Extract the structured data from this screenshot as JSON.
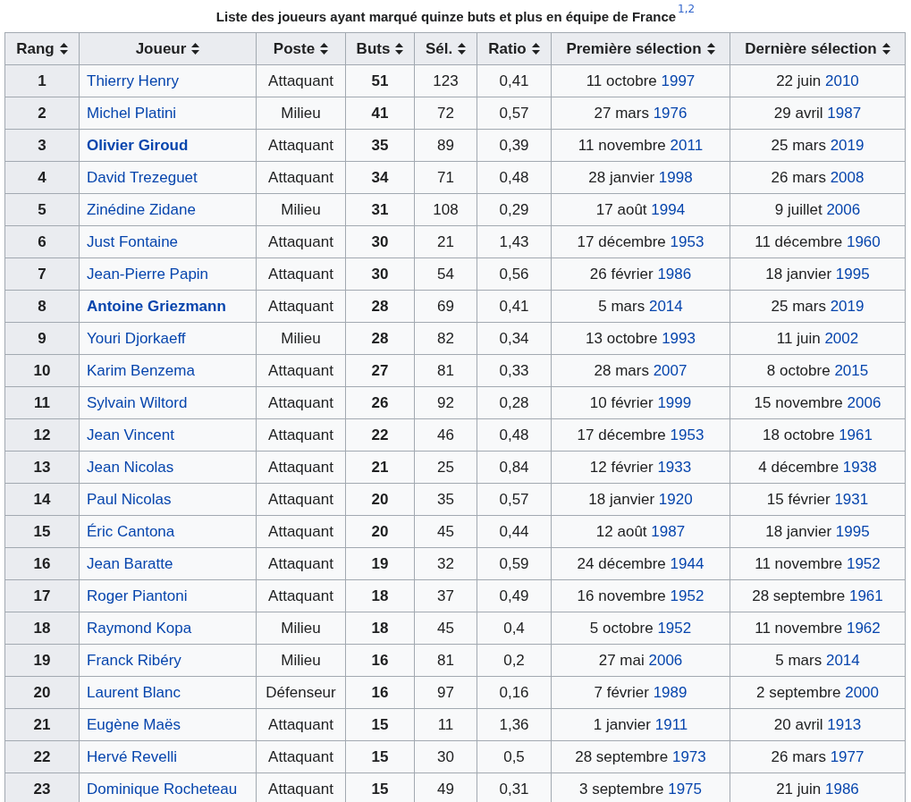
{
  "caption": {
    "text": "Liste des joueurs ayant marqué quinze buts et plus en équipe de France",
    "note": "1,2"
  },
  "columns": [
    "Rang",
    "Joueur",
    "Poste",
    "Buts",
    "Sél.",
    "Ratio",
    "Première sélection",
    "Dernière sélection"
  ],
  "rows": [
    {
      "rank": "1",
      "player": "Thierry Henry",
      "active": false,
      "position": "Attaquant",
      "goals": "51",
      "caps": "123",
      "ratio": "0,41",
      "first": {
        "day": "11 octobre",
        "year": "1997"
      },
      "last": {
        "day": "22 juin",
        "year": "2010"
      }
    },
    {
      "rank": "2",
      "player": "Michel Platini",
      "active": false,
      "position": "Milieu",
      "goals": "41",
      "caps": "72",
      "ratio": "0,57",
      "first": {
        "day": "27 mars",
        "year": "1976"
      },
      "last": {
        "day": "29 avril",
        "year": "1987"
      }
    },
    {
      "rank": "3",
      "player": "Olivier Giroud",
      "active": true,
      "position": "Attaquant",
      "goals": "35",
      "caps": "89",
      "ratio": "0,39",
      "first": {
        "day": "11 novembre",
        "year": "2011"
      },
      "last": {
        "day": "25 mars",
        "year": "2019"
      }
    },
    {
      "rank": "4",
      "player": "David Trezeguet",
      "active": false,
      "position": "Attaquant",
      "goals": "34",
      "caps": "71",
      "ratio": "0,48",
      "first": {
        "day": "28 janvier",
        "year": "1998"
      },
      "last": {
        "day": "26 mars",
        "year": "2008"
      }
    },
    {
      "rank": "5",
      "player": "Zinédine Zidane",
      "active": false,
      "position": "Milieu",
      "goals": "31",
      "caps": "108",
      "ratio": "0,29",
      "first": {
        "day": "17 août",
        "year": "1994"
      },
      "last": {
        "day": "9 juillet",
        "year": "2006"
      }
    },
    {
      "rank": "6",
      "player": "Just Fontaine",
      "active": false,
      "position": "Attaquant",
      "goals": "30",
      "caps": "21",
      "ratio": "1,43",
      "first": {
        "day": "17 décembre",
        "year": "1953"
      },
      "last": {
        "day": "11 décembre",
        "year": "1960"
      }
    },
    {
      "rank": "7",
      "player": "Jean-Pierre Papin",
      "active": false,
      "position": "Attaquant",
      "goals": "30",
      "caps": "54",
      "ratio": "0,56",
      "first": {
        "day": "26 février",
        "year": "1986"
      },
      "last": {
        "day": "18 janvier",
        "year": "1995"
      }
    },
    {
      "rank": "8",
      "player": "Antoine Griezmann",
      "active": true,
      "position": "Attaquant",
      "goals": "28",
      "caps": "69",
      "ratio": "0,41",
      "first": {
        "day": "5 mars",
        "year": "2014"
      },
      "last": {
        "day": "25 mars",
        "year": "2019"
      }
    },
    {
      "rank": "9",
      "player": "Youri Djorkaeff",
      "active": false,
      "position": "Milieu",
      "goals": "28",
      "caps": "82",
      "ratio": "0,34",
      "first": {
        "day": "13 octobre",
        "year": "1993"
      },
      "last": {
        "day": "11 juin",
        "year": "2002"
      }
    },
    {
      "rank": "10",
      "player": "Karim Benzema",
      "active": false,
      "position": "Attaquant",
      "goals": "27",
      "caps": "81",
      "ratio": "0,33",
      "first": {
        "day": "28 mars",
        "year": "2007"
      },
      "last": {
        "day": "8 octobre",
        "year": "2015"
      }
    },
    {
      "rank": "11",
      "player": "Sylvain Wiltord",
      "active": false,
      "position": "Attaquant",
      "goals": "26",
      "caps": "92",
      "ratio": "0,28",
      "first": {
        "day": "10 février",
        "year": "1999"
      },
      "last": {
        "day": "15 novembre",
        "year": "2006"
      }
    },
    {
      "rank": "12",
      "player": "Jean Vincent",
      "active": false,
      "position": "Attaquant",
      "goals": "22",
      "caps": "46",
      "ratio": "0,48",
      "first": {
        "day": "17 décembre",
        "year": "1953"
      },
      "last": {
        "day": "18 octobre",
        "year": "1961"
      }
    },
    {
      "rank": "13",
      "player": "Jean Nicolas",
      "active": false,
      "position": "Attaquant",
      "goals": "21",
      "caps": "25",
      "ratio": "0,84",
      "first": {
        "day": "12 février",
        "year": "1933"
      },
      "last": {
        "day": "4 décembre",
        "year": "1938"
      }
    },
    {
      "rank": "14",
      "player": "Paul Nicolas",
      "active": false,
      "position": "Attaquant",
      "goals": "20",
      "caps": "35",
      "ratio": "0,57",
      "first": {
        "day": "18 janvier",
        "year": "1920"
      },
      "last": {
        "day": "15 février",
        "year": "1931"
      }
    },
    {
      "rank": "15",
      "player": "Éric Cantona",
      "active": false,
      "position": "Attaquant",
      "goals": "20",
      "caps": "45",
      "ratio": "0,44",
      "first": {
        "day": "12 août",
        "year": "1987"
      },
      "last": {
        "day": "18 janvier",
        "year": "1995"
      }
    },
    {
      "rank": "16",
      "player": "Jean Baratte",
      "active": false,
      "position": "Attaquant",
      "goals": "19",
      "caps": "32",
      "ratio": "0,59",
      "first": {
        "day": "24 décembre",
        "year": "1944"
      },
      "last": {
        "day": "11 novembre",
        "year": "1952"
      }
    },
    {
      "rank": "17",
      "player": "Roger Piantoni",
      "active": false,
      "position": "Attaquant",
      "goals": "18",
      "caps": "37",
      "ratio": "0,49",
      "first": {
        "day": "16 novembre",
        "year": "1952"
      },
      "last": {
        "day": "28 septembre",
        "year": "1961"
      }
    },
    {
      "rank": "18",
      "player": "Raymond Kopa",
      "active": false,
      "position": "Milieu",
      "goals": "18",
      "caps": "45",
      "ratio": "0,4",
      "first": {
        "day": "5 octobre",
        "year": "1952"
      },
      "last": {
        "day": "11 novembre",
        "year": "1962"
      }
    },
    {
      "rank": "19",
      "player": "Franck Ribéry",
      "active": false,
      "position": "Milieu",
      "goals": "16",
      "caps": "81",
      "ratio": "0,2",
      "first": {
        "day": "27 mai",
        "year": "2006"
      },
      "last": {
        "day": "5 mars",
        "year": "2014"
      }
    },
    {
      "rank": "20",
      "player": "Laurent Blanc",
      "active": false,
      "position": "Défenseur",
      "goals": "16",
      "caps": "97",
      "ratio": "0,16",
      "first": {
        "day": "7 février",
        "year": "1989"
      },
      "last": {
        "day": "2 septembre",
        "year": "2000"
      }
    },
    {
      "rank": "21",
      "player": "Eugène Maës",
      "active": false,
      "position": "Attaquant",
      "goals": "15",
      "caps": "11",
      "ratio": "1,36",
      "first": {
        "day": "1 janvier",
        "year": "1911"
      },
      "last": {
        "day": "20 avril",
        "year": "1913"
      }
    },
    {
      "rank": "22",
      "player": "Hervé Revelli",
      "active": false,
      "position": "Attaquant",
      "goals": "15",
      "caps": "30",
      "ratio": "0,5",
      "first": {
        "day": "28 septembre",
        "year": "1973"
      },
      "last": {
        "day": "26 mars",
        "year": "1977"
      }
    },
    {
      "rank": "23",
      "player": "Dominique Rocheteau",
      "active": false,
      "position": "Attaquant",
      "goals": "15",
      "caps": "49",
      "ratio": "0,31",
      "first": {
        "day": "3 septembre",
        "year": "1975"
      },
      "last": {
        "day": "21 juin",
        "year": "1986"
      }
    }
  ]
}
